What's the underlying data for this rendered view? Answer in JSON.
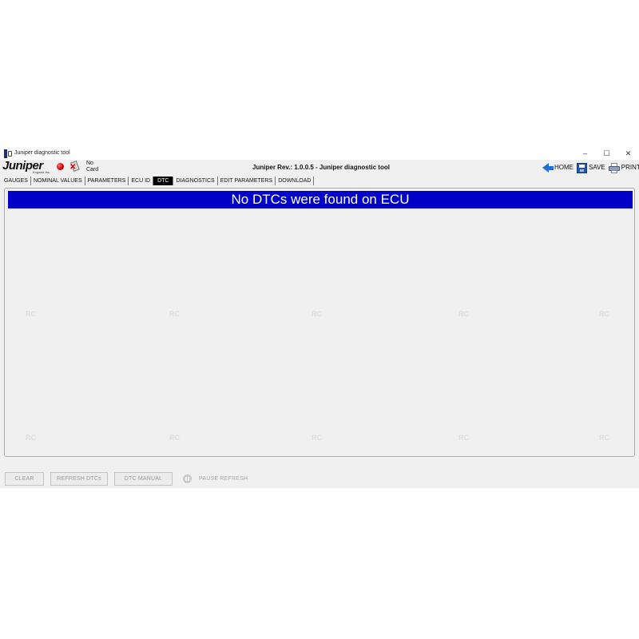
{
  "window": {
    "title": "Juniper diagnostic tool",
    "controls": {
      "minimize": "–",
      "maximize": "☐",
      "close": "✕"
    }
  },
  "header": {
    "logo_text": "Juniper",
    "logo_subtext": "Engines Inc.",
    "card_status": "No Card",
    "app_title": "Juniper Rev.: 1.0.0.5 - Juniper diagnostic tool",
    "actions": [
      {
        "label": "HOME",
        "icon": "home-arrow-icon"
      },
      {
        "label": "SAVE",
        "icon": "floppy-disk-icon"
      },
      {
        "label": "PRINT",
        "icon": "printer-icon"
      }
    ]
  },
  "tabs": [
    {
      "label": "GAUGES",
      "active": false
    },
    {
      "label": "NOMINAL VALUES",
      "active": false
    },
    {
      "label": "PARAMETERS",
      "active": false
    },
    {
      "label": "ECU ID",
      "active": false
    },
    {
      "label": "DTC",
      "active": true
    },
    {
      "label": "DIAGNOSTICS",
      "active": false
    },
    {
      "label": "EDIT PARAMETERS",
      "active": false
    },
    {
      "label": "DOWNLOAD",
      "active": false
    }
  ],
  "main": {
    "banner_text": "No DTCs were found on ECU",
    "banner_color": "#0000c8"
  },
  "bottom": {
    "clear_label": "CLEAR",
    "refresh_label": "REFRESH DTCs",
    "manual_label": "DTC MANUAL",
    "pause_label": "PAUSE REFRESH"
  },
  "watermark": "RC"
}
